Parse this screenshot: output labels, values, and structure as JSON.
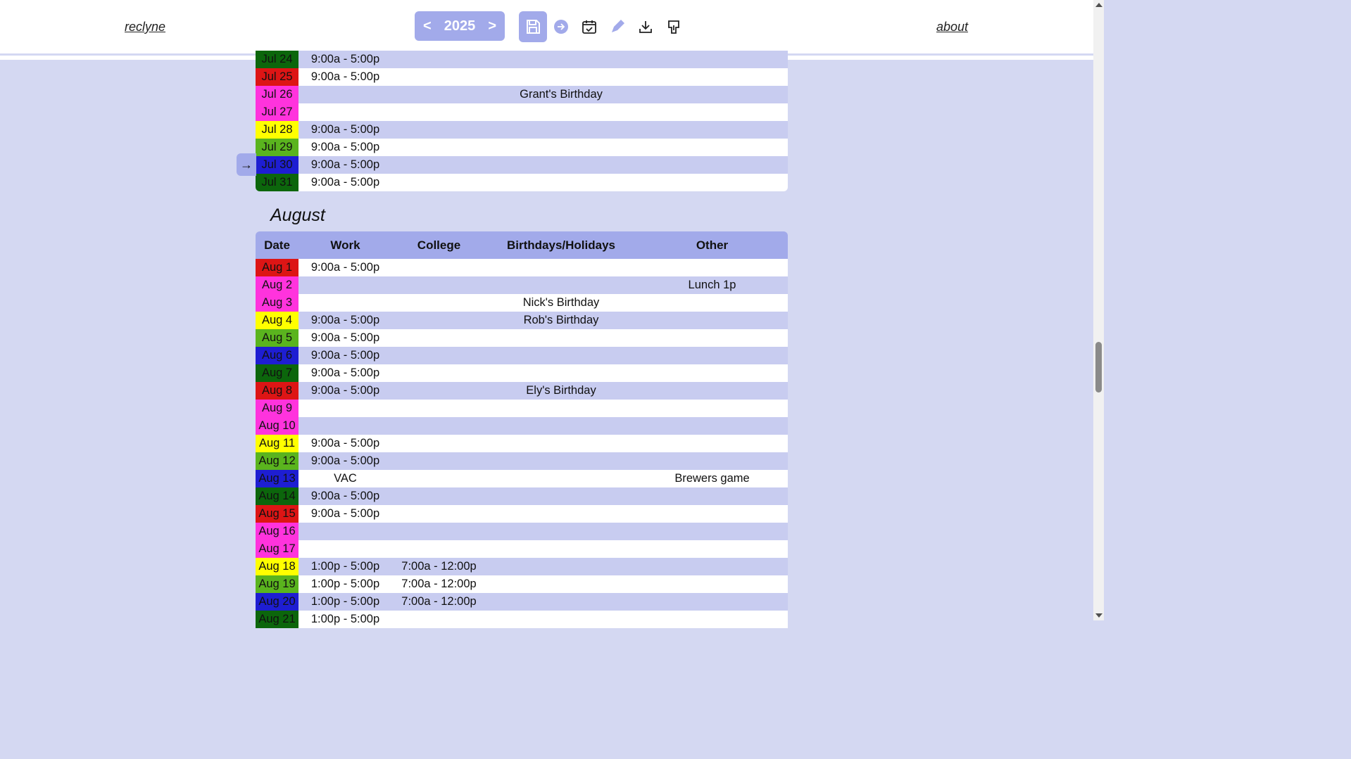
{
  "header": {
    "brand": "reclyne",
    "about": "about",
    "year": "2025",
    "prev": "<",
    "next": ">",
    "icons": [
      "save-icon",
      "go-today-icon",
      "calendar-check-icon",
      "pencil-icon",
      "download-icon",
      "export-icon"
    ]
  },
  "colors": {
    "accent": "#a2aaea",
    "background": "#d4d8f2",
    "row_alt": "#c8ccf0",
    "day_colors": [
      "#dd1515",
      "#ff33dd",
      "#ff33dd",
      "#ffff00",
      "#5ab41e",
      "#1e1ed2",
      "#0c660c"
    ]
  },
  "july": {
    "today_arrow": "→",
    "rows": [
      {
        "date": "Jul 24",
        "work": "9:00a - 5:00p",
        "college": "",
        "bday": "",
        "other": ""
      },
      {
        "date": "Jul 25",
        "work": "9:00a - 5:00p",
        "college": "",
        "bday": "",
        "other": ""
      },
      {
        "date": "Jul 26",
        "work": "",
        "college": "",
        "bday": "Grant's Birthday",
        "other": ""
      },
      {
        "date": "Jul 27",
        "work": "",
        "college": "",
        "bday": "",
        "other": ""
      },
      {
        "date": "Jul 28",
        "work": "9:00a - 5:00p",
        "college": "",
        "bday": "",
        "other": ""
      },
      {
        "date": "Jul 29",
        "work": "9:00a - 5:00p",
        "college": "",
        "bday": "",
        "other": ""
      },
      {
        "date": "Jul 30",
        "work": "9:00a - 5:00p",
        "college": "",
        "bday": "",
        "other": ""
      },
      {
        "date": "Jul 31",
        "work": "9:00a - 5:00p",
        "college": "",
        "bday": "",
        "other": ""
      }
    ]
  },
  "august": {
    "title": "August",
    "columns": {
      "date": "Date",
      "work": "Work",
      "college": "College",
      "bday": "Birthdays/Holidays",
      "other": "Other"
    },
    "rows": [
      {
        "date": "Aug 1",
        "work": "9:00a - 5:00p",
        "college": "",
        "bday": "",
        "other": ""
      },
      {
        "date": "Aug 2",
        "work": "",
        "college": "",
        "bday": "",
        "other": "Lunch 1p"
      },
      {
        "date": "Aug 3",
        "work": "",
        "college": "",
        "bday": "Nick's Birthday",
        "other": ""
      },
      {
        "date": "Aug 4",
        "work": "9:00a - 5:00p",
        "college": "",
        "bday": "Rob's Birthday",
        "other": ""
      },
      {
        "date": "Aug 5",
        "work": "9:00a - 5:00p",
        "college": "",
        "bday": "",
        "other": ""
      },
      {
        "date": "Aug 6",
        "work": "9:00a - 5:00p",
        "college": "",
        "bday": "",
        "other": ""
      },
      {
        "date": "Aug 7",
        "work": "9:00a - 5:00p",
        "college": "",
        "bday": "",
        "other": ""
      },
      {
        "date": "Aug 8",
        "work": "9:00a - 5:00p",
        "college": "",
        "bday": "Ely's Birthday",
        "other": ""
      },
      {
        "date": "Aug 9",
        "work": "",
        "college": "",
        "bday": "",
        "other": ""
      },
      {
        "date": "Aug 10",
        "work": "",
        "college": "",
        "bday": "",
        "other": ""
      },
      {
        "date": "Aug 11",
        "work": "9:00a - 5:00p",
        "college": "",
        "bday": "",
        "other": ""
      },
      {
        "date": "Aug 12",
        "work": "9:00a - 5:00p",
        "college": "",
        "bday": "",
        "other": ""
      },
      {
        "date": "Aug 13",
        "work": "VAC",
        "college": "",
        "bday": "",
        "other": "Brewers game"
      },
      {
        "date": "Aug 14",
        "work": "9:00a - 5:00p",
        "college": "",
        "bday": "",
        "other": ""
      },
      {
        "date": "Aug 15",
        "work": "9:00a - 5:00p",
        "college": "",
        "bday": "",
        "other": ""
      },
      {
        "date": "Aug 16",
        "work": "",
        "college": "",
        "bday": "",
        "other": ""
      },
      {
        "date": "Aug 17",
        "work": "",
        "college": "",
        "bday": "",
        "other": ""
      },
      {
        "date": "Aug 18",
        "work": "1:00p - 5:00p",
        "college": "7:00a - 12:00p",
        "bday": "",
        "other": ""
      },
      {
        "date": "Aug 19",
        "work": "1:00p - 5:00p",
        "college": "7:00a - 12:00p",
        "bday": "",
        "other": ""
      },
      {
        "date": "Aug 20",
        "work": "1:00p - 5:00p",
        "college": "7:00a - 12:00p",
        "bday": "",
        "other": ""
      },
      {
        "date": "Aug 21",
        "work": "1:00p - 5:00p",
        "college": "",
        "bday": "",
        "other": ""
      }
    ]
  }
}
